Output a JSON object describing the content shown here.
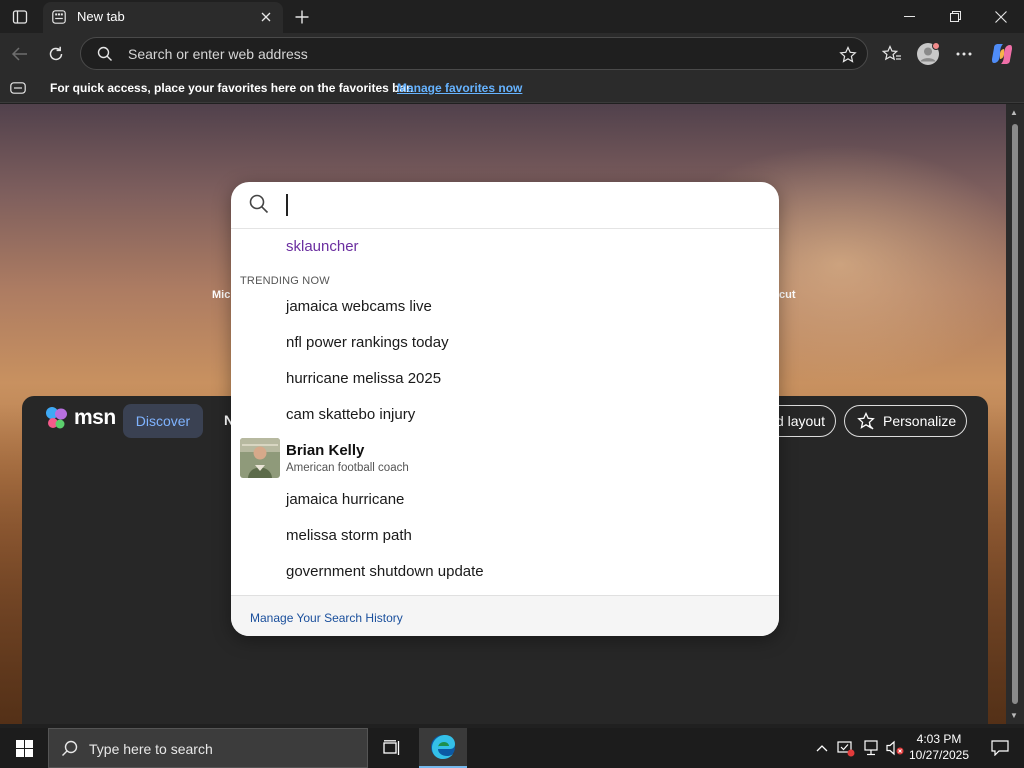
{
  "browser": {
    "tab_title": "New tab",
    "address_placeholder": "Search or enter web address"
  },
  "favorites_bar": {
    "message": "For quick access, place your favorites here on the favorites bar.",
    "link": "Manage favorites now"
  },
  "background_page": {
    "left_text": "Mic",
    "right_text": "cut",
    "msn": {
      "logo_text": "msn",
      "discover": "Discover",
      "next_tab": "N",
      "layout_button": "d layout",
      "personalize_button": "Personalize"
    }
  },
  "search_dropdown": {
    "history": [
      {
        "text": "sklauncher"
      }
    ],
    "trending_label": "TRENDING NOW",
    "trending": [
      {
        "text": "jamaica webcams live"
      },
      {
        "text": "nfl power rankings today"
      },
      {
        "text": "hurricane melissa 2025"
      },
      {
        "text": "cam skattebo injury"
      }
    ],
    "entity": {
      "name": "Brian Kelly",
      "description": "American football coach"
    },
    "trending_more": [
      {
        "text": "jamaica hurricane"
      },
      {
        "text": "melissa storm path"
      },
      {
        "text": "government shutdown update"
      }
    ],
    "footer_link": "Manage Your Search History"
  },
  "taskbar": {
    "search_placeholder": "Type here to search",
    "time": "4:03 PM",
    "date": "10/27/2025"
  },
  "colors": {
    "history_text": "#6b2fa0",
    "link_blue": "#66b3ff",
    "footer_link": "#1a4f9c",
    "discover_bg": "#3a4152"
  }
}
